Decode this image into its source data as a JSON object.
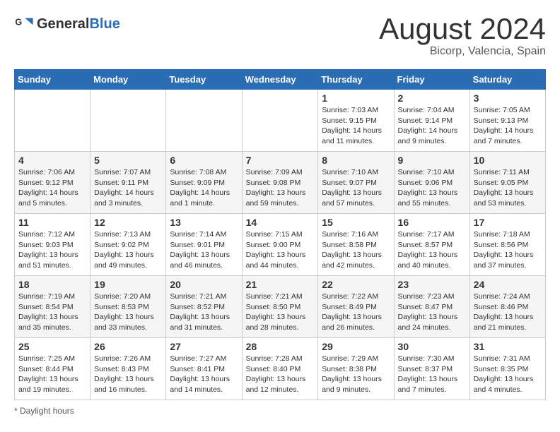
{
  "header": {
    "logo_general": "General",
    "logo_blue": "Blue",
    "month_year": "August 2024",
    "location": "Bicorp, Valencia, Spain"
  },
  "days_of_week": [
    "Sunday",
    "Monday",
    "Tuesday",
    "Wednesday",
    "Thursday",
    "Friday",
    "Saturday"
  ],
  "weeks": [
    [
      {
        "day": "",
        "info": ""
      },
      {
        "day": "",
        "info": ""
      },
      {
        "day": "",
        "info": ""
      },
      {
        "day": "",
        "info": ""
      },
      {
        "day": "1",
        "info": "Sunrise: 7:03 AM\nSunset: 9:15 PM\nDaylight: 14 hours and 11 minutes."
      },
      {
        "day": "2",
        "info": "Sunrise: 7:04 AM\nSunset: 9:14 PM\nDaylight: 14 hours and 9 minutes."
      },
      {
        "day": "3",
        "info": "Sunrise: 7:05 AM\nSunset: 9:13 PM\nDaylight: 14 hours and 7 minutes."
      }
    ],
    [
      {
        "day": "4",
        "info": "Sunrise: 7:06 AM\nSunset: 9:12 PM\nDaylight: 14 hours and 5 minutes."
      },
      {
        "day": "5",
        "info": "Sunrise: 7:07 AM\nSunset: 9:11 PM\nDaylight: 14 hours and 3 minutes."
      },
      {
        "day": "6",
        "info": "Sunrise: 7:08 AM\nSunset: 9:09 PM\nDaylight: 14 hours and 1 minute."
      },
      {
        "day": "7",
        "info": "Sunrise: 7:09 AM\nSunset: 9:08 PM\nDaylight: 13 hours and 59 minutes."
      },
      {
        "day": "8",
        "info": "Sunrise: 7:10 AM\nSunset: 9:07 PM\nDaylight: 13 hours and 57 minutes."
      },
      {
        "day": "9",
        "info": "Sunrise: 7:10 AM\nSunset: 9:06 PM\nDaylight: 13 hours and 55 minutes."
      },
      {
        "day": "10",
        "info": "Sunrise: 7:11 AM\nSunset: 9:05 PM\nDaylight: 13 hours and 53 minutes."
      }
    ],
    [
      {
        "day": "11",
        "info": "Sunrise: 7:12 AM\nSunset: 9:03 PM\nDaylight: 13 hours and 51 minutes."
      },
      {
        "day": "12",
        "info": "Sunrise: 7:13 AM\nSunset: 9:02 PM\nDaylight: 13 hours and 49 minutes."
      },
      {
        "day": "13",
        "info": "Sunrise: 7:14 AM\nSunset: 9:01 PM\nDaylight: 13 hours and 46 minutes."
      },
      {
        "day": "14",
        "info": "Sunrise: 7:15 AM\nSunset: 9:00 PM\nDaylight: 13 hours and 44 minutes."
      },
      {
        "day": "15",
        "info": "Sunrise: 7:16 AM\nSunset: 8:58 PM\nDaylight: 13 hours and 42 minutes."
      },
      {
        "day": "16",
        "info": "Sunrise: 7:17 AM\nSunset: 8:57 PM\nDaylight: 13 hours and 40 minutes."
      },
      {
        "day": "17",
        "info": "Sunrise: 7:18 AM\nSunset: 8:56 PM\nDaylight: 13 hours and 37 minutes."
      }
    ],
    [
      {
        "day": "18",
        "info": "Sunrise: 7:19 AM\nSunset: 8:54 PM\nDaylight: 13 hours and 35 minutes."
      },
      {
        "day": "19",
        "info": "Sunrise: 7:20 AM\nSunset: 8:53 PM\nDaylight: 13 hours and 33 minutes."
      },
      {
        "day": "20",
        "info": "Sunrise: 7:21 AM\nSunset: 8:52 PM\nDaylight: 13 hours and 31 minutes."
      },
      {
        "day": "21",
        "info": "Sunrise: 7:21 AM\nSunset: 8:50 PM\nDaylight: 13 hours and 28 minutes."
      },
      {
        "day": "22",
        "info": "Sunrise: 7:22 AM\nSunset: 8:49 PM\nDaylight: 13 hours and 26 minutes."
      },
      {
        "day": "23",
        "info": "Sunrise: 7:23 AM\nSunset: 8:47 PM\nDaylight: 13 hours and 24 minutes."
      },
      {
        "day": "24",
        "info": "Sunrise: 7:24 AM\nSunset: 8:46 PM\nDaylight: 13 hours and 21 minutes."
      }
    ],
    [
      {
        "day": "25",
        "info": "Sunrise: 7:25 AM\nSunset: 8:44 PM\nDaylight: 13 hours and 19 minutes."
      },
      {
        "day": "26",
        "info": "Sunrise: 7:26 AM\nSunset: 8:43 PM\nDaylight: 13 hours and 16 minutes."
      },
      {
        "day": "27",
        "info": "Sunrise: 7:27 AM\nSunset: 8:41 PM\nDaylight: 13 hours and 14 minutes."
      },
      {
        "day": "28",
        "info": "Sunrise: 7:28 AM\nSunset: 8:40 PM\nDaylight: 13 hours and 12 minutes."
      },
      {
        "day": "29",
        "info": "Sunrise: 7:29 AM\nSunset: 8:38 PM\nDaylight: 13 hours and 9 minutes."
      },
      {
        "day": "30",
        "info": "Sunrise: 7:30 AM\nSunset: 8:37 PM\nDaylight: 13 hours and 7 minutes."
      },
      {
        "day": "31",
        "info": "Sunrise: 7:31 AM\nSunset: 8:35 PM\nDaylight: 13 hours and 4 minutes."
      }
    ]
  ],
  "footer": {
    "note": "Daylight hours"
  }
}
